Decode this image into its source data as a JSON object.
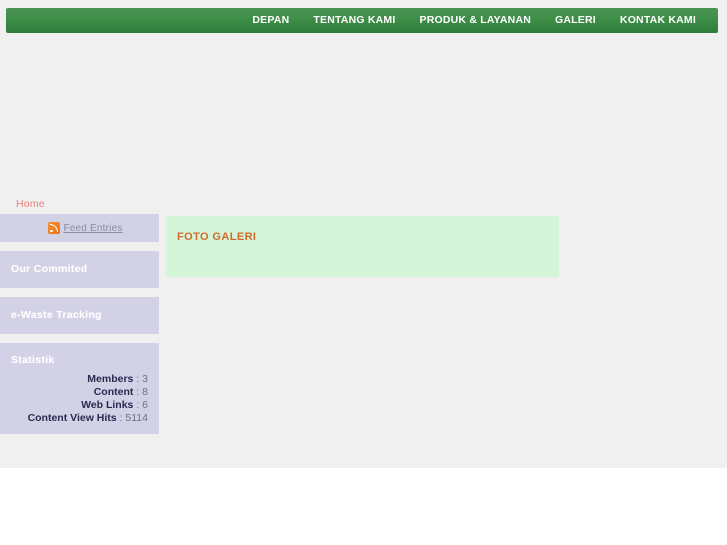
{
  "site": {
    "accent_green": "#409049",
    "sidebar_bg": "#d3d1e6",
    "content_bg": "#d4f5d9",
    "content_heading_color": "#d2692b",
    "breadcrumb_color": "#f07a7a",
    "page_bg": "#f0f0f0"
  },
  "nav": {
    "items": [
      {
        "label": "DEPAN",
        "name": "nav-item-depan"
      },
      {
        "label": "TENTANG KAMI",
        "name": "nav-item-tentang-kami"
      },
      {
        "label": "PRODUK & LAYANAN",
        "name": "nav-item-produk-layanan"
      },
      {
        "label": "GALERI",
        "name": "nav-item-galeri"
      },
      {
        "label": "KONTAK KAMI",
        "name": "nav-item-kontak-kami"
      }
    ]
  },
  "breadcrumb": {
    "items": [
      {
        "label": "Home"
      }
    ]
  },
  "sidebar": {
    "modules": [
      {
        "name": "module-feed",
        "title": "",
        "feed": {
          "icon": "rss-icon",
          "link_label": "Feed Entries"
        }
      },
      {
        "name": "module-commited",
        "title": "Our Commited"
      },
      {
        "name": "module-ewaste",
        "title": "e-Waste Tracking"
      },
      {
        "name": "module-stats",
        "title": "Statistik",
        "stats": [
          {
            "label": "Members",
            "separator": ":",
            "value": "3"
          },
          {
            "label": "Content",
            "separator": ":",
            "value": "8"
          },
          {
            "label": "Web Links",
            "separator": ":",
            "value": "6"
          },
          {
            "label": "Content View Hits",
            "separator": ":",
            "value": "5114"
          }
        ]
      }
    ]
  },
  "main": {
    "title": "FOTO GALERI",
    "gallery_items": []
  }
}
